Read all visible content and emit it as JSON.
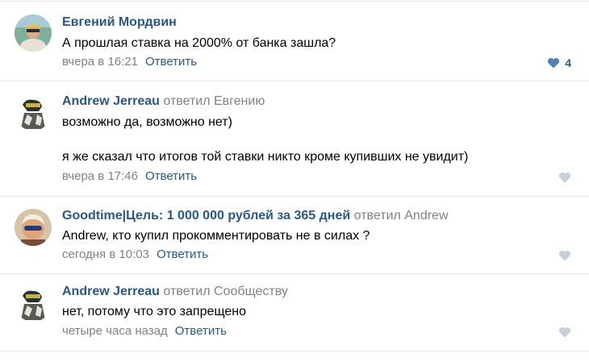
{
  "comments": [
    {
      "author": "Евгений Мордвин",
      "replied_to": "",
      "lines": [
        "А прошлая ставка на 2000% от банка зашла?"
      ],
      "date": "вчера в 16:21",
      "reply_label": "Ответить",
      "likes": "4",
      "liked": true
    },
    {
      "author": "Andrew Jerreau",
      "replied_to": "ответил Евгению",
      "lines": [
        "возможно да, возможно нет)",
        "я же сказал что итогов той ставки никто кроме купивших не увидит)"
      ],
      "date": "вчера в 17:46",
      "reply_label": "Ответить",
      "likes": "",
      "liked": false
    },
    {
      "author": "Goodtime|Цель: 1 000 000 рублей за 365 дней",
      "replied_to": "ответил Andrew",
      "lines": [
        "Andrew, кто купил прокомментировать не в силах ?"
      ],
      "date": "сегодня в 10:03",
      "reply_label": "Ответить",
      "likes": "",
      "liked": false
    },
    {
      "author": "Andrew Jerreau",
      "replied_to": "ответил Сообществу",
      "lines": [
        "нет, потому что это запрещено"
      ],
      "date": "четыре часа назад",
      "reply_label": "Ответить",
      "likes": "",
      "liked": false
    }
  ],
  "colors": {
    "link": "#2a5885",
    "secondary": "#828282",
    "like_active": "#5181b8",
    "like_inactive": "#c5d0db",
    "separator": "#e7e8ec"
  },
  "icons": {
    "like": "heart-icon"
  }
}
